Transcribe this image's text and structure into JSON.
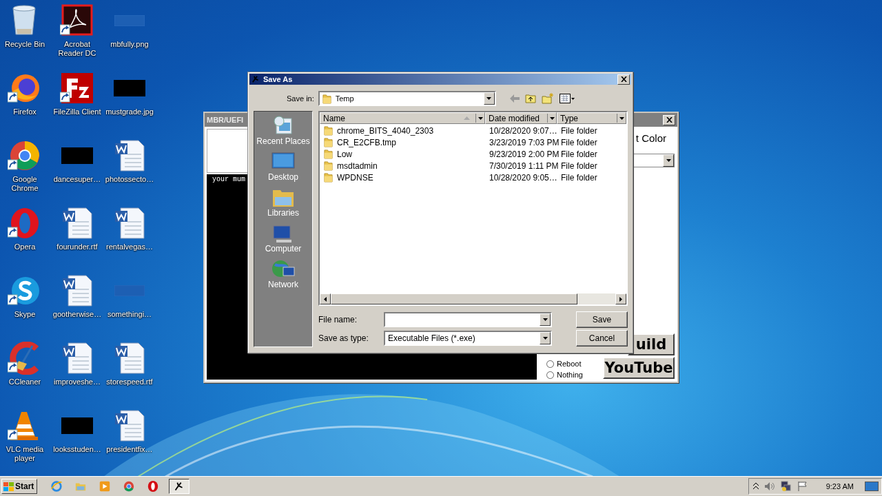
{
  "desktop": {
    "icons": [
      {
        "label": "Recycle Bin",
        "kind": "bin",
        "shortcut": false
      },
      {
        "label": "Acrobat Reader DC",
        "kind": "pdf",
        "shortcut": true
      },
      {
        "label": "mbfully.png",
        "kind": "image-blank",
        "shortcut": false
      },
      {
        "label": "Firefox",
        "kind": "firefox",
        "shortcut": true
      },
      {
        "label": "FileZilla Client",
        "kind": "filezilla",
        "shortcut": true
      },
      {
        "label": "mustgrade.jpg",
        "kind": "image-dark",
        "shortcut": false
      },
      {
        "label": "Google Chrome",
        "kind": "chrome",
        "shortcut": true
      },
      {
        "label": "dancesuper…",
        "kind": "image-dark",
        "shortcut": false
      },
      {
        "label": "photossecto…",
        "kind": "word",
        "shortcut": false
      },
      {
        "label": "Opera",
        "kind": "opera",
        "shortcut": true
      },
      {
        "label": "fourunder.rtf",
        "kind": "word",
        "shortcut": false
      },
      {
        "label": "rentalvegas…",
        "kind": "word",
        "shortcut": false
      },
      {
        "label": "Skype",
        "kind": "skype",
        "shortcut": true
      },
      {
        "label": "gootherwise…",
        "kind": "word",
        "shortcut": false
      },
      {
        "label": "somethingi…",
        "kind": "image-blank",
        "shortcut": false
      },
      {
        "label": "CCleaner",
        "kind": "ccleaner",
        "shortcut": true
      },
      {
        "label": "improveshe…",
        "kind": "word",
        "shortcut": false
      },
      {
        "label": "storespeed.rtf",
        "kind": "word",
        "shortcut": false
      },
      {
        "label": "VLC media player",
        "kind": "vlc",
        "shortcut": true
      },
      {
        "label": "looksstuden…",
        "kind": "image-dark",
        "shortcut": false
      },
      {
        "label": "presidentfix…",
        "kind": "word",
        "shortcut": false
      }
    ]
  },
  "background_window": {
    "title": "MBR/UEFI",
    "console_text": "your mum",
    "color_label": "t Color",
    "build_button": "uild",
    "radios": [
      {
        "label": "Reboot",
        "selected": false
      },
      {
        "label": "Nothing",
        "selected": false
      }
    ],
    "youtube_button": "YouTube"
  },
  "dialog": {
    "title": "Save As",
    "save_in_label": "Save in:",
    "save_in_value": "Temp",
    "places": [
      {
        "label": "Recent Places",
        "kind": "recent"
      },
      {
        "label": "Desktop",
        "kind": "desktop"
      },
      {
        "label": "Libraries",
        "kind": "libraries"
      },
      {
        "label": "Computer",
        "kind": "computer"
      },
      {
        "label": "Network",
        "kind": "network"
      }
    ],
    "columns": [
      "Name",
      "Date modified",
      "Type"
    ],
    "rows": [
      {
        "name": "chrome_BITS_4040_2303",
        "date": "10/28/2020 9:07…",
        "type": "File folder"
      },
      {
        "name": "CR_E2CFB.tmp",
        "date": "3/23/2019 7:03 PM",
        "type": "File folder"
      },
      {
        "name": "Low",
        "date": "9/23/2019 2:00 PM",
        "type": "File folder"
      },
      {
        "name": "msdtadmin",
        "date": "7/30/2019 1:11 PM",
        "type": "File folder"
      },
      {
        "name": "WPDNSE",
        "date": "10/28/2020 9:05…",
        "type": "File folder"
      }
    ],
    "file_name_label": "File name:",
    "save_type_label": "Save as type:",
    "save_type_value": "Executable Files (*.exe)",
    "buttons": [
      "Save",
      "Cancel"
    ]
  },
  "taskbar": {
    "start": "Start",
    "apps": [
      {
        "kind": "ie",
        "pressed": false
      },
      {
        "kind": "explorer",
        "pressed": false
      },
      {
        "kind": "media",
        "pressed": false
      },
      {
        "kind": "chrome",
        "pressed": false
      },
      {
        "kind": "opera",
        "pressed": false
      },
      {
        "kind": "app",
        "pressed": true
      }
    ],
    "time": "9:23 AM"
  }
}
